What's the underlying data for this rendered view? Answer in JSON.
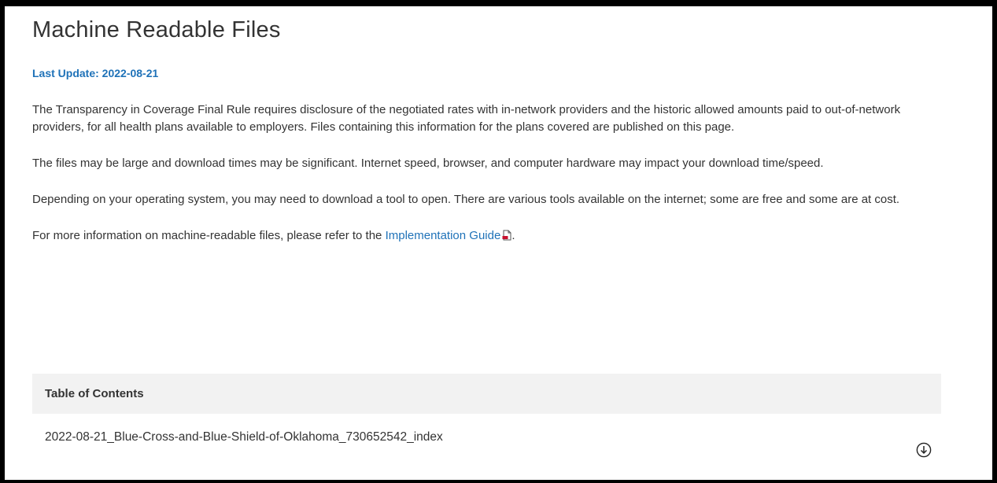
{
  "page": {
    "title": "Machine Readable Files",
    "last_update": "Last Update: 2022-08-21"
  },
  "paragraphs": {
    "p1": "The Transparency in Coverage Final Rule requires disclosure of the negotiated rates with in-network providers and the historic allowed amounts paid to out-of-network providers, for all health plans available to employers.  Files containing this information for the plans covered are published on this page.",
    "p2": "The files may be large and download times may be significant. Internet speed, browser, and computer hardware may impact your download time/speed.",
    "p3": "Depending on your operating system, you may need to download a tool to open.  There are various tools available on the internet; some are free and some are at cost.",
    "p4_prefix": "For more information on machine-readable files, please refer to the ",
    "p4_link": "Implementation Guide",
    "p4_suffix": "."
  },
  "toc": {
    "header": "Table of Contents",
    "items": [
      {
        "label": "2022-08-21_Blue-Cross-and-Blue-Shield-of-Oklahoma_730652542_index",
        "icon": "download-icon"
      }
    ]
  },
  "colors": {
    "accent": "#1f72b8",
    "text": "#333333",
    "toc_header_bg": "#f2f2f2",
    "pdf_icon": "#c8102e"
  }
}
